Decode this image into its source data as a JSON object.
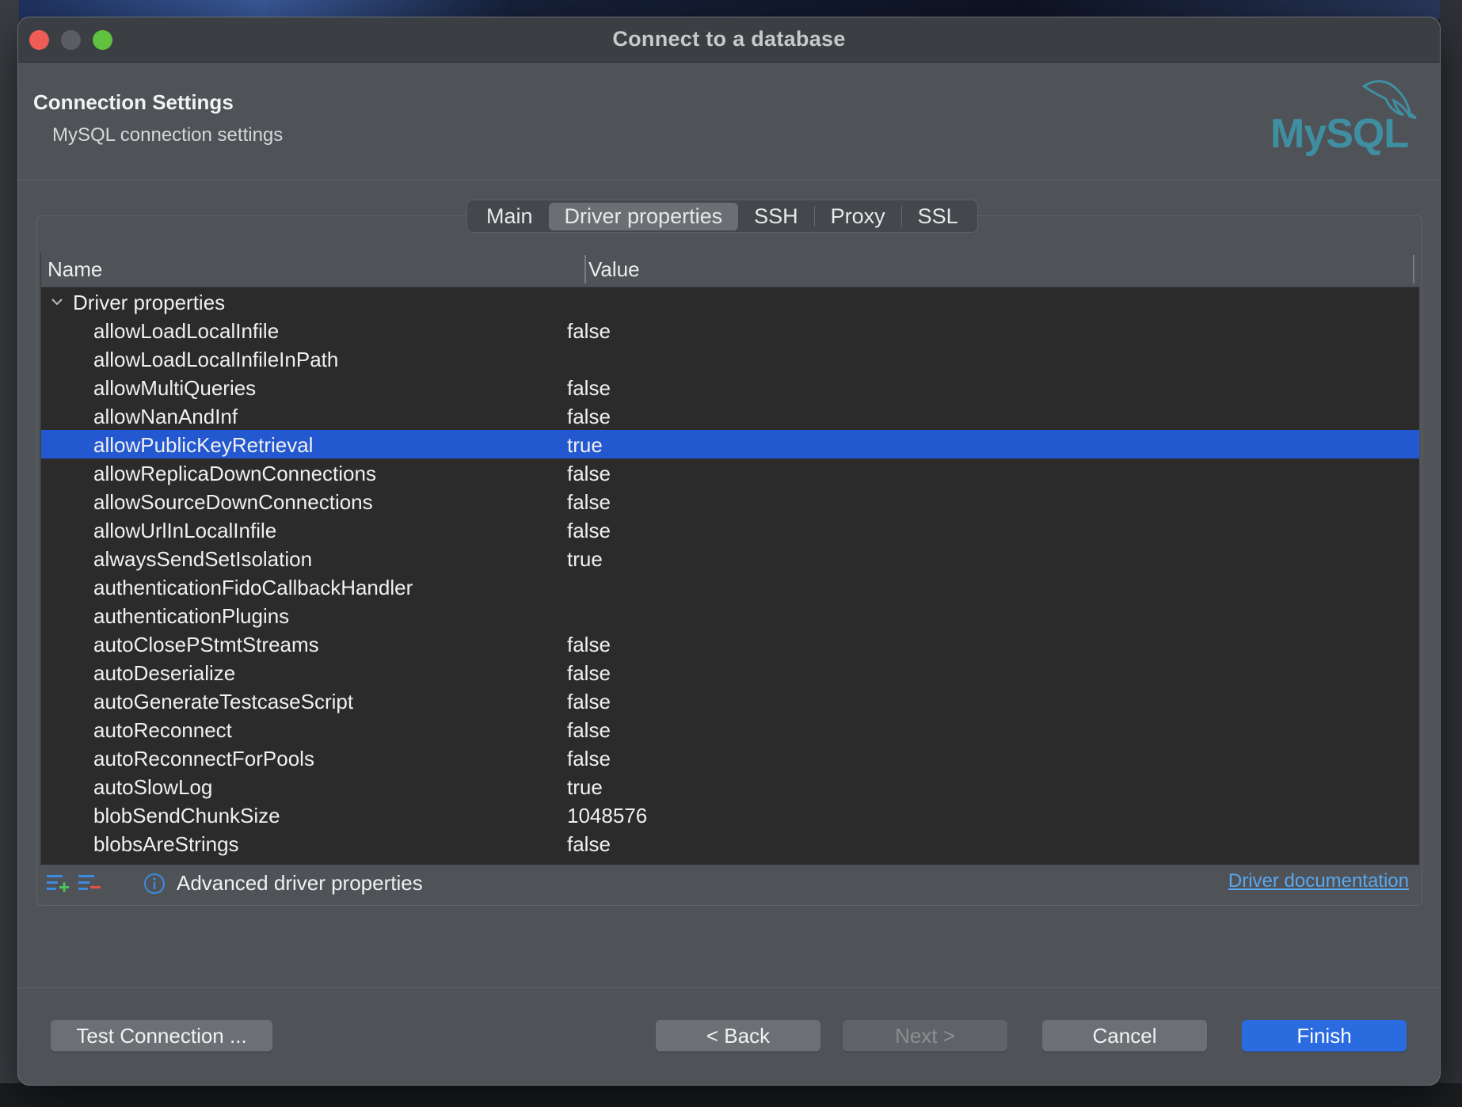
{
  "window": {
    "title": "Connect to a database"
  },
  "header": {
    "title": "Connection Settings",
    "subtitle": "MySQL connection settings",
    "logo_text": "MySQL"
  },
  "tabs": [
    {
      "label": "Main",
      "active": false
    },
    {
      "label": "Driver properties",
      "active": true
    },
    {
      "label": "SSH",
      "active": false
    },
    {
      "label": "Proxy",
      "active": false
    },
    {
      "label": "SSL",
      "active": false
    }
  ],
  "table": {
    "col_name": "Name",
    "col_value": "Value",
    "group_label": "Driver properties",
    "rows": [
      {
        "name": "allowLoadLocalInfile",
        "value": "false"
      },
      {
        "name": "allowLoadLocalInfileInPath",
        "value": ""
      },
      {
        "name": "allowMultiQueries",
        "value": "false"
      },
      {
        "name": "allowNanAndInf",
        "value": "false"
      },
      {
        "name": "allowPublicKeyRetrieval",
        "value": "true",
        "selected": true
      },
      {
        "name": "allowReplicaDownConnections",
        "value": "false"
      },
      {
        "name": "allowSourceDownConnections",
        "value": "false"
      },
      {
        "name": "allowUrlInLocalInfile",
        "value": "false"
      },
      {
        "name": "alwaysSendSetIsolation",
        "value": "true"
      },
      {
        "name": "authenticationFidoCallbackHandler",
        "value": ""
      },
      {
        "name": "authenticationPlugins",
        "value": ""
      },
      {
        "name": "autoClosePStmtStreams",
        "value": "false"
      },
      {
        "name": "autoDeserialize",
        "value": "false"
      },
      {
        "name": "autoGenerateTestcaseScript",
        "value": "false"
      },
      {
        "name": "autoReconnect",
        "value": "false"
      },
      {
        "name": "autoReconnectForPools",
        "value": "false"
      },
      {
        "name": "autoSlowLog",
        "value": "true"
      },
      {
        "name": "blobSendChunkSize",
        "value": "1048576"
      },
      {
        "name": "blobsAreStrings",
        "value": "false"
      }
    ]
  },
  "footer": {
    "advanced_label": "Advanced driver properties",
    "doc_link": "Driver documentation"
  },
  "buttons": {
    "test": "Test Connection ...",
    "back": "< Back",
    "next": "Next >",
    "cancel": "Cancel",
    "finish": "Finish"
  },
  "colors": {
    "selection": "#2358d0",
    "primary_button": "#2b6be0",
    "link": "#5aa7f0",
    "logo_teal": "#3f8fa3",
    "logo_orange": "#e49a2e"
  }
}
